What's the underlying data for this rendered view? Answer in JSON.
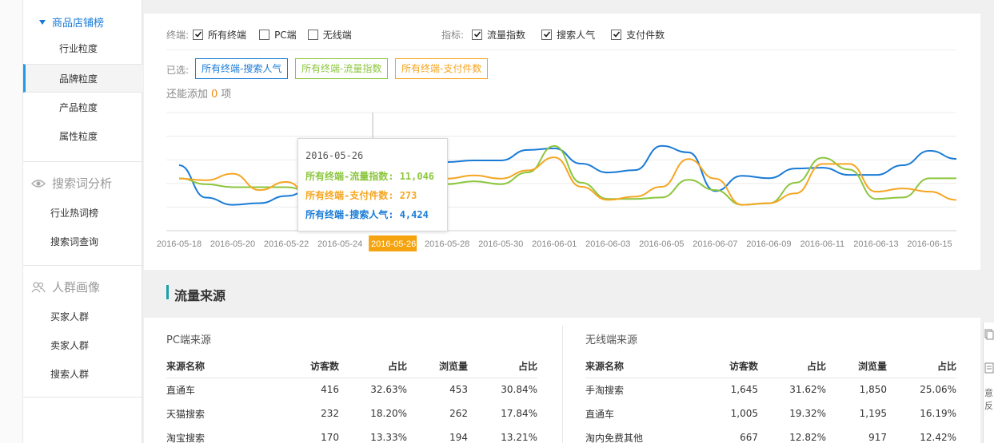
{
  "sidebar": {
    "section_title": "商品店铺榜",
    "items": [
      {
        "label": "行业粒度"
      },
      {
        "label": "品牌粒度"
      },
      {
        "label": "产品粒度"
      },
      {
        "label": "属性粒度"
      }
    ],
    "search_group": {
      "title": "搜索词分析",
      "items": [
        {
          "label": "行业热词榜"
        },
        {
          "label": "搜索词查询"
        }
      ]
    },
    "crowd_group": {
      "title": "人群画像",
      "items": [
        {
          "label": "买家人群"
        },
        {
          "label": "卖家人群"
        },
        {
          "label": "搜索人群"
        }
      ]
    }
  },
  "filters": {
    "terminal_label": "终端:",
    "terminals": [
      {
        "label": "所有终端",
        "checked": true
      },
      {
        "label": "PC端",
        "checked": false
      },
      {
        "label": "无线端",
        "checked": false
      }
    ],
    "metric_label": "指标:",
    "metrics": [
      {
        "label": "流量指数",
        "checked": true
      },
      {
        "label": "搜索人气",
        "checked": true
      },
      {
        "label": "支付件数",
        "checked": true
      }
    ]
  },
  "selected": {
    "label": "已选:",
    "tags": [
      {
        "label": "所有终端-搜索人气",
        "color": "#1a7bd6"
      },
      {
        "label": "所有终端-流量指数",
        "color": "#8cc63e"
      },
      {
        "label": "所有终端-支付件数",
        "color": "#f5a623"
      }
    ],
    "remain_prefix": "还能添加",
    "remain_count": "0",
    "remain_suffix": "项"
  },
  "chart_data": {
    "type": "line",
    "x": [
      "2016-05-18",
      "2016-05-19",
      "2016-05-20",
      "2016-05-21",
      "2016-05-22",
      "2016-05-23",
      "2016-05-24",
      "2016-05-25",
      "2016-05-26",
      "2016-05-27",
      "2016-05-28",
      "2016-05-29",
      "2016-05-30",
      "2016-05-31",
      "2016-06-01",
      "2016-06-02",
      "2016-06-03",
      "2016-06-04",
      "2016-06-05",
      "2016-06-06",
      "2016-06-07",
      "2016-06-08",
      "2016-06-09",
      "2016-06-10",
      "2016-06-11",
      "2016-06-12",
      "2016-06-13",
      "2016-06-14",
      "2016-06-15",
      "2016-06-16"
    ],
    "x_tick_labels": [
      "2016-05-18",
      "2016-05-20",
      "2016-05-22",
      "2016-05-24",
      "2016-05-26",
      "2016-05-28",
      "2016-05-30",
      "2016-06-01",
      "2016-06-03",
      "2016-06-05",
      "2016-06-07",
      "2016-06-09",
      "2016-06-11",
      "2016-06-13",
      "2016-06-15"
    ],
    "highlight_x": "2016-05-26",
    "series": [
      {
        "name": "所有终端-搜索人气",
        "color": "#1a7bd6",
        "values": [
          5400,
          3400,
          2950,
          3050,
          3500,
          3950,
          4200,
          4350,
          4424,
          4900,
          5600,
          5700,
          5700,
          6350,
          6450,
          5500,
          4950,
          5100,
          6600,
          6200,
          3800,
          4750,
          4600,
          5200,
          5250,
          4800,
          4800,
          5400,
          6300,
          5800
        ]
      },
      {
        "name": "所有终端-流量指数",
        "color": "#8cc63e",
        "values": [
          10000,
          9800,
          9700,
          9700,
          9700,
          9500,
          9450,
          9300,
          11046,
          9400,
          9800,
          9900,
          9800,
          10200,
          11100,
          9850,
          9300,
          9300,
          9350,
          9950,
          9600,
          9100,
          9150,
          9850,
          10700,
          10300,
          9300,
          9350,
          10000,
          10000
        ]
      },
      {
        "name": "所有终端-支付件数",
        "color": "#f5a623",
        "values": [
          253,
          252,
          256,
          246,
          251,
          241,
          240,
          243,
          273,
          247,
          253,
          255,
          253,
          258,
          266,
          248,
          240,
          242,
          248,
          265,
          253,
          237,
          238,
          244,
          262,
          262,
          245,
          247,
          245,
          240
        ]
      }
    ],
    "tooltip": {
      "date": "2016-05-26",
      "rows": [
        {
          "label": "所有终端-流量指数:",
          "value": "11,046",
          "color": "#8cc63e"
        },
        {
          "label": "所有终端-支付件数:",
          "value": "273",
          "color": "#f5a623"
        },
        {
          "label": "所有终端-搜索人气:",
          "value": "4,424",
          "color": "#1a7bd6"
        }
      ]
    },
    "grid": true
  },
  "traffic": {
    "title": "流量来源",
    "pc": {
      "title": "PC端来源",
      "columns": [
        "来源名称",
        "访客数",
        "占比",
        "浏览量",
        "占比"
      ],
      "rows": [
        [
          "直通车",
          "416",
          "32.63%",
          "453",
          "30.84%"
        ],
        [
          "天猫搜索",
          "232",
          "18.20%",
          "262",
          "17.84%"
        ],
        [
          "淘宝搜索",
          "170",
          "13.33%",
          "194",
          "13.21%"
        ]
      ]
    },
    "mobile": {
      "title": "无线端来源",
      "columns": [
        "来源名称",
        "访客数",
        "占比",
        "浏览量",
        "占比"
      ],
      "rows": [
        [
          "手淘搜索",
          "1,645",
          "31.62%",
          "1,850",
          "25.06%"
        ],
        [
          "直通车",
          "1,005",
          "19.32%",
          "1,195",
          "16.19%"
        ],
        [
          "淘内免费其他",
          "667",
          "12.82%",
          "917",
          "12.42%"
        ]
      ]
    }
  },
  "right_strip": {
    "text1": "意",
    "text2": "反"
  }
}
